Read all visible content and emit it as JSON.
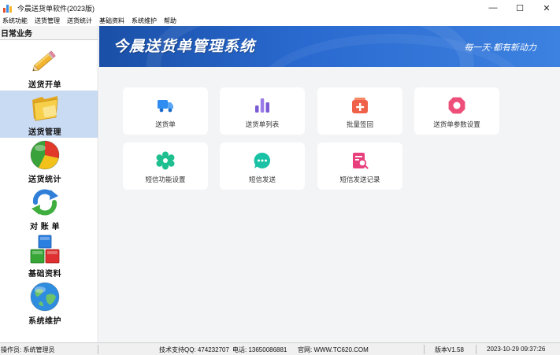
{
  "window": {
    "title": "今晨送货单软件(2023版)",
    "minimize": "—",
    "maximize": "☐",
    "close": "✕"
  },
  "menu": [
    "系统功能",
    "送货管理",
    "送货统计",
    "基础资料",
    "系统维护",
    "帮助"
  ],
  "sidebar": {
    "header": "日常业务",
    "items": [
      {
        "label": "送货开单",
        "icon": "pencil-icon"
      },
      {
        "label": "送货管理",
        "icon": "folder-icon"
      },
      {
        "label": "送货统计",
        "icon": "pie-chart-icon"
      },
      {
        "label": "对 账 单",
        "icon": "refresh-arrows-icon"
      },
      {
        "label": "基础资料",
        "icon": "blocks-icon"
      },
      {
        "label": "系统维护",
        "icon": "globe-icon"
      }
    ],
    "active_index": 1
  },
  "banner": {
    "title": "今晨送货单管理系统",
    "slogan": "每一天·都有新动力"
  },
  "cards": [
    {
      "label": "送货单",
      "icon": "truck-icon",
      "color": "#2f8cf0"
    },
    {
      "label": "送货单列表",
      "icon": "bar-chart-icon",
      "color": "#7b5ad6"
    },
    {
      "label": "批量签回",
      "icon": "add-box-icon",
      "color": "#f0614a"
    },
    {
      "label": "送货单参数设置",
      "icon": "gear-ring-icon",
      "color": "#ee4f7a"
    },
    {
      "label": "短信功能设置",
      "icon": "flower-gear-icon",
      "color": "#1fbf8f"
    },
    {
      "label": "短信发送",
      "icon": "chat-bubble-icon",
      "color": "#19c2a4"
    },
    {
      "label": "短信发送记录",
      "icon": "document-search-icon",
      "color": "#e8407d"
    }
  ],
  "status": {
    "operator": "操作员: 系统管理员",
    "support_qq": "技术支持QQ: 474232707",
    "phone": "电话: 13650086881",
    "website": "官网: WWW.TC620.COM",
    "version": "版本V1.58",
    "datetime": "2023-10-29  09:37:26"
  }
}
